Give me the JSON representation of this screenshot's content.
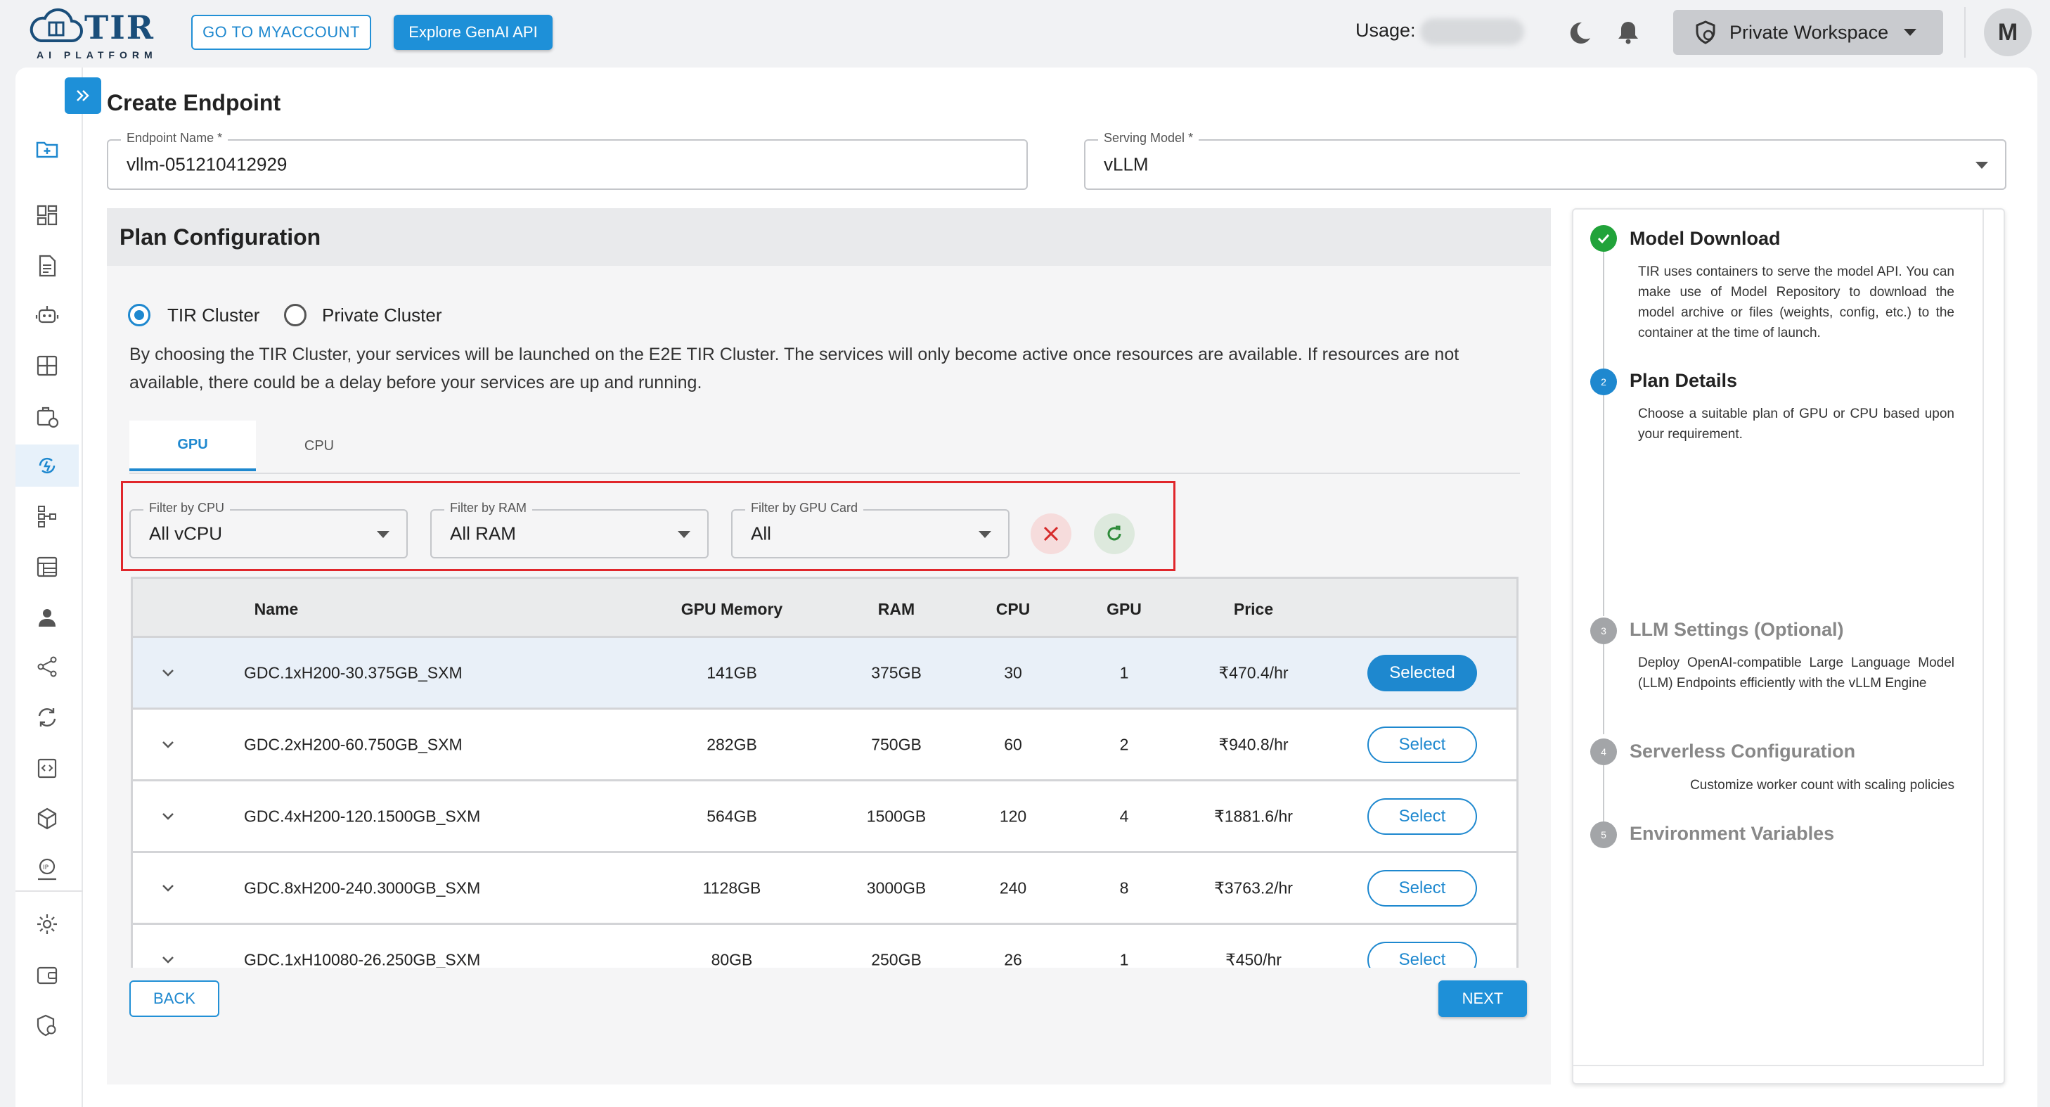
{
  "header": {
    "logo_text": "TIR",
    "logo_subtext": "AI PLATFORM",
    "go_to_myaccount": "GO TO MYACCOUNT",
    "explore_genai": "Explore GenAI API",
    "usage_label": "Usage:",
    "workspace": "Private Workspace",
    "avatar_initial": "M"
  },
  "page": {
    "title": "Create Endpoint",
    "endpoint_name_label": "Endpoint Name",
    "endpoint_name_value": "vllm-051210412929",
    "serving_model_label": "Serving Model",
    "serving_model_value": "vLLM"
  },
  "plan": {
    "title": "Plan Configuration",
    "cluster_options": [
      "TIR Cluster",
      "Private Cluster"
    ],
    "selected_cluster": "TIR Cluster",
    "description": "By choosing the TIR Cluster, your services will be launched on the E2E TIR Cluster. The services will only become active once resources are available. If resources are not available, there could be a delay before your services are up and running.",
    "tabs": [
      "GPU",
      "CPU"
    ],
    "active_tab": "GPU",
    "filters": {
      "cpu": {
        "label": "Filter by CPU",
        "value": "All vCPU"
      },
      "ram": {
        "label": "Filter by RAM",
        "value": "All RAM"
      },
      "gpu_card": {
        "label": "Filter by GPU Card",
        "value": "All"
      }
    },
    "table": {
      "columns": [
        "Name",
        "GPU Memory",
        "RAM",
        "CPU",
        "GPU",
        "Price"
      ],
      "rows": [
        {
          "name": "GDC.1xH200-30.375GB_SXM",
          "gpu_memory": "141GB",
          "ram": "375GB",
          "cpu": "30",
          "gpu": "1",
          "price": "₹470.4/hr",
          "action": "Selected"
        },
        {
          "name": "GDC.2xH200-60.750GB_SXM",
          "gpu_memory": "282GB",
          "ram": "750GB",
          "cpu": "60",
          "gpu": "2",
          "price": "₹940.8/hr",
          "action": "Select"
        },
        {
          "name": "GDC.4xH200-120.1500GB_SXM",
          "gpu_memory": "564GB",
          "ram": "1500GB",
          "cpu": "120",
          "gpu": "4",
          "price": "₹1881.6/hr",
          "action": "Select"
        },
        {
          "name": "GDC.8xH200-240.3000GB_SXM",
          "gpu_memory": "1128GB",
          "ram": "3000GB",
          "cpu": "240",
          "gpu": "8",
          "price": "₹3763.2/hr",
          "action": "Select"
        },
        {
          "name": "GDC.1xH10080-26.250GB_SXM",
          "gpu_memory": "80GB",
          "ram": "250GB",
          "cpu": "26",
          "gpu": "1",
          "price": "₹450/hr",
          "action": "Select"
        }
      ]
    },
    "back": "BACK",
    "next": "NEXT"
  },
  "steps": [
    {
      "num": "1",
      "title": "Model Download",
      "state": "done",
      "desc": "TIR uses containers to serve the model API. You can make use of Model Repository to download the model archive or files (weights, config, etc.) to the container at the time of launch."
    },
    {
      "num": "2",
      "title": "Plan Details",
      "state": "current",
      "desc": "Choose a suitable plan of GPU or CPU based upon your requirement."
    },
    {
      "num": "3",
      "title": "LLM Settings (Optional)",
      "state": "pending",
      "desc": "Deploy OpenAI-compatible Large Language Model (LLM) Endpoints efficiently with the vLLM Engine"
    },
    {
      "num": "4",
      "title": "Serverless Configuration",
      "state": "pending",
      "desc": "Customize worker count with scaling policies"
    },
    {
      "num": "5",
      "title": "Environment Variables",
      "state": "pending",
      "desc": ""
    }
  ],
  "sidebar_icons": [
    "folder-add-icon",
    "dashboard-icon",
    "notebook-icon",
    "bot-icon",
    "grid-icon",
    "training-icon",
    "inference-icon",
    "pipeline-icon",
    "dataset-icon",
    "user-icon",
    "share-icon",
    "sync-icon",
    "code-icon",
    "cube-icon",
    "ip-icon",
    "settings-icon",
    "wallet-icon",
    "security-icon"
  ],
  "colors": {
    "accent": "#1e88cf",
    "success": "#21a33a",
    "highlight_border": "#e0262b"
  }
}
